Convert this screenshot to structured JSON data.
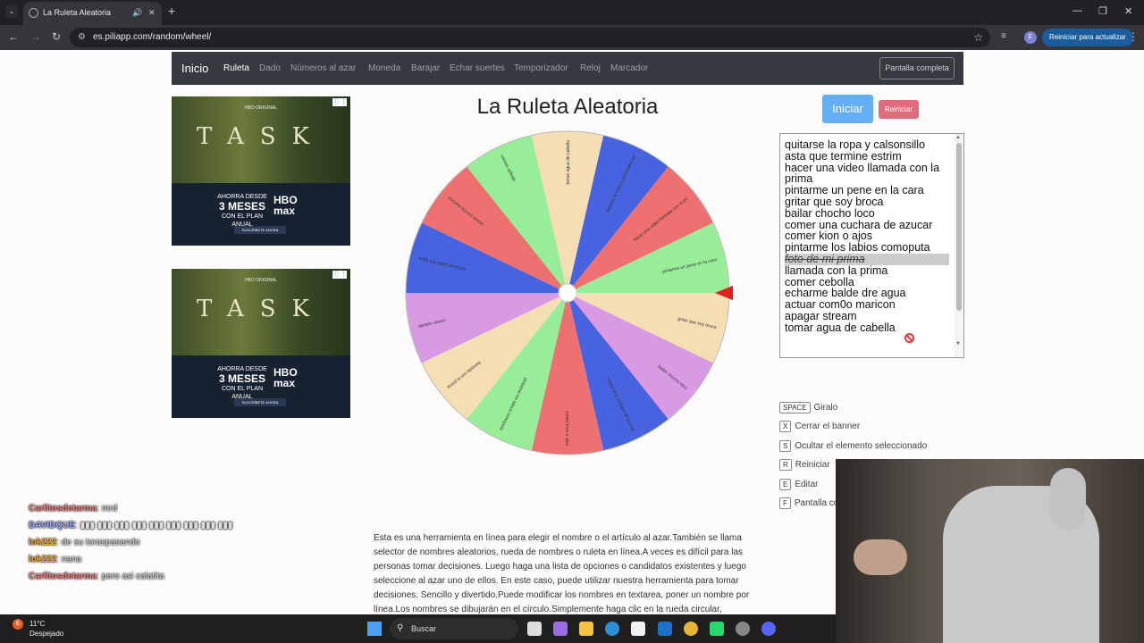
{
  "browser": {
    "tab_title": "La Ruleta Aleatoria",
    "url": "es.piliapp.com/random/wheel/",
    "update_label": "Reiniciar para actualizar",
    "profile_initial": "F"
  },
  "navbar": {
    "brand": "Inicio",
    "links": [
      "Ruleta",
      "Dado",
      "Números al azar",
      "Moneda",
      "Barajar",
      "Echar suertes",
      "Temporizador",
      "Reloj",
      "Marcador"
    ],
    "fullscreen_label": "Pantalla completa"
  },
  "ads": {
    "top_label": "HBO ORIGINAL",
    "title": "TASK",
    "promo_line1": "AHORRA DESDE",
    "promo_big": "3 MESES",
    "promo_line2": "CON EL PLAN ANUAL",
    "brand": "HBO max",
    "cta": "SUSCRÍBETE AHORA"
  },
  "page_title": "La Ruleta Aleatoria",
  "buttons": {
    "start": "Iniciar",
    "reset": "Reiniciar"
  },
  "wheel": {
    "segments": [
      {
        "label": "tomar agua de cabella",
        "color": "#f5deb3"
      },
      {
        "label": "quitarse la ropa y calsonsillo asta que termine estrim",
        "color": "#4863e0"
      },
      {
        "label": "hacer una video llamada con la prima",
        "color": "#ef7070"
      },
      {
        "label": "pintarme un pene en la cara",
        "color": "#98ee98"
      },
      {
        "label": "gritar que soy broca",
        "color": "#f5deb3"
      },
      {
        "label": "bailar chocho loco",
        "color": "#d89be3"
      },
      {
        "label": "comer una cuchara de azucar",
        "color": "#4863e0"
      },
      {
        "label": "comer kion o ajos",
        "color": "#ef7070"
      },
      {
        "label": "pintarme los labios comoputa",
        "color": "#98ee98"
      },
      {
        "label": "llamada con la prima",
        "color": "#f5deb3"
      },
      {
        "label": "comer cebolla",
        "color": "#d89be3"
      },
      {
        "label": "echarme balde dre agua",
        "color": "#4863e0"
      },
      {
        "label": "actuar com0o maricon",
        "color": "#ef7070"
      },
      {
        "label": "apagar stream",
        "color": "#98ee98"
      }
    ],
    "pointer_color": "#e0201c"
  },
  "options_list": {
    "lines": [
      "quitarse la ropa y calsonsillo",
      "asta que termine estrim",
      "hacer una video llamada con la",
      "prima",
      "pintarme un pene en la cara",
      "gritar que soy broca",
      "bailar chocho loco",
      "comer una cuchara de azucar",
      "comer kion o ajos",
      "pintarme los labios comoputa",
      "foto de mi prima",
      "llamada con la prima",
      "comer cebolla",
      "echarme balde dre agua",
      "actuar com0o maricon",
      "apagar stream",
      "tomar agua de cabella"
    ],
    "hidden_index": 10
  },
  "shortcuts": [
    {
      "key": "SPACE",
      "label": "Giralo"
    },
    {
      "key": "X",
      "label": "Cerrar el banner"
    },
    {
      "key": "S",
      "label": "Ocultar el elemento seleccionado"
    },
    {
      "key": "R",
      "label": "Reiniciar"
    },
    {
      "key": "E",
      "label": "Editar"
    },
    {
      "key": "F",
      "label": "Pantalla co"
    }
  ],
  "description": "Esta es una herramienta en línea para elegir el nombre o el artículo al azar.También se llama selector de nombres aleatorios, rueda de nombres o ruleta en línea.A veces es difícil para las personas tomar decisiones. Luego haga una lista de opciones o candidatos existentes y luego seleccione al azar uno de ellos. En este caso, puede utilizar nuestra herramienta para tomar decisiones. Sencillo y divertido.Puede modificar los nombres en textarea, poner un nombre por línea.Los nombres se dibujarán en el círculo.Simplemente haga clic en la rueda circular,",
  "chat": [
    {
      "user": "Carlitosdetarma",
      "msg": ": mrd",
      "color": "#f08080"
    },
    {
      "user": "DAVIDQUE",
      "msg": ": ▮▮▮ ▮▮▮ ▮▮▮ ▮▮▮ ▮▮▮ ▮▮▮ ▮▮▮ ▮▮▮ ▮▮▮",
      "color": "#9aa6ff"
    },
    {
      "user": "lok222",
      "msg": ": de su toraspasando",
      "color": "#f5a623"
    },
    {
      "user": "lok222",
      "msg": ": nana",
      "color": "#f5a623"
    },
    {
      "user": "Carlitosdetarma",
      "msg": ": pero asi calatita",
      "color": "#f08080"
    }
  ],
  "taskbar": {
    "temp": "11°C",
    "condition": "Despejado",
    "search_label": "Buscar",
    "weather_badge": "6"
  }
}
